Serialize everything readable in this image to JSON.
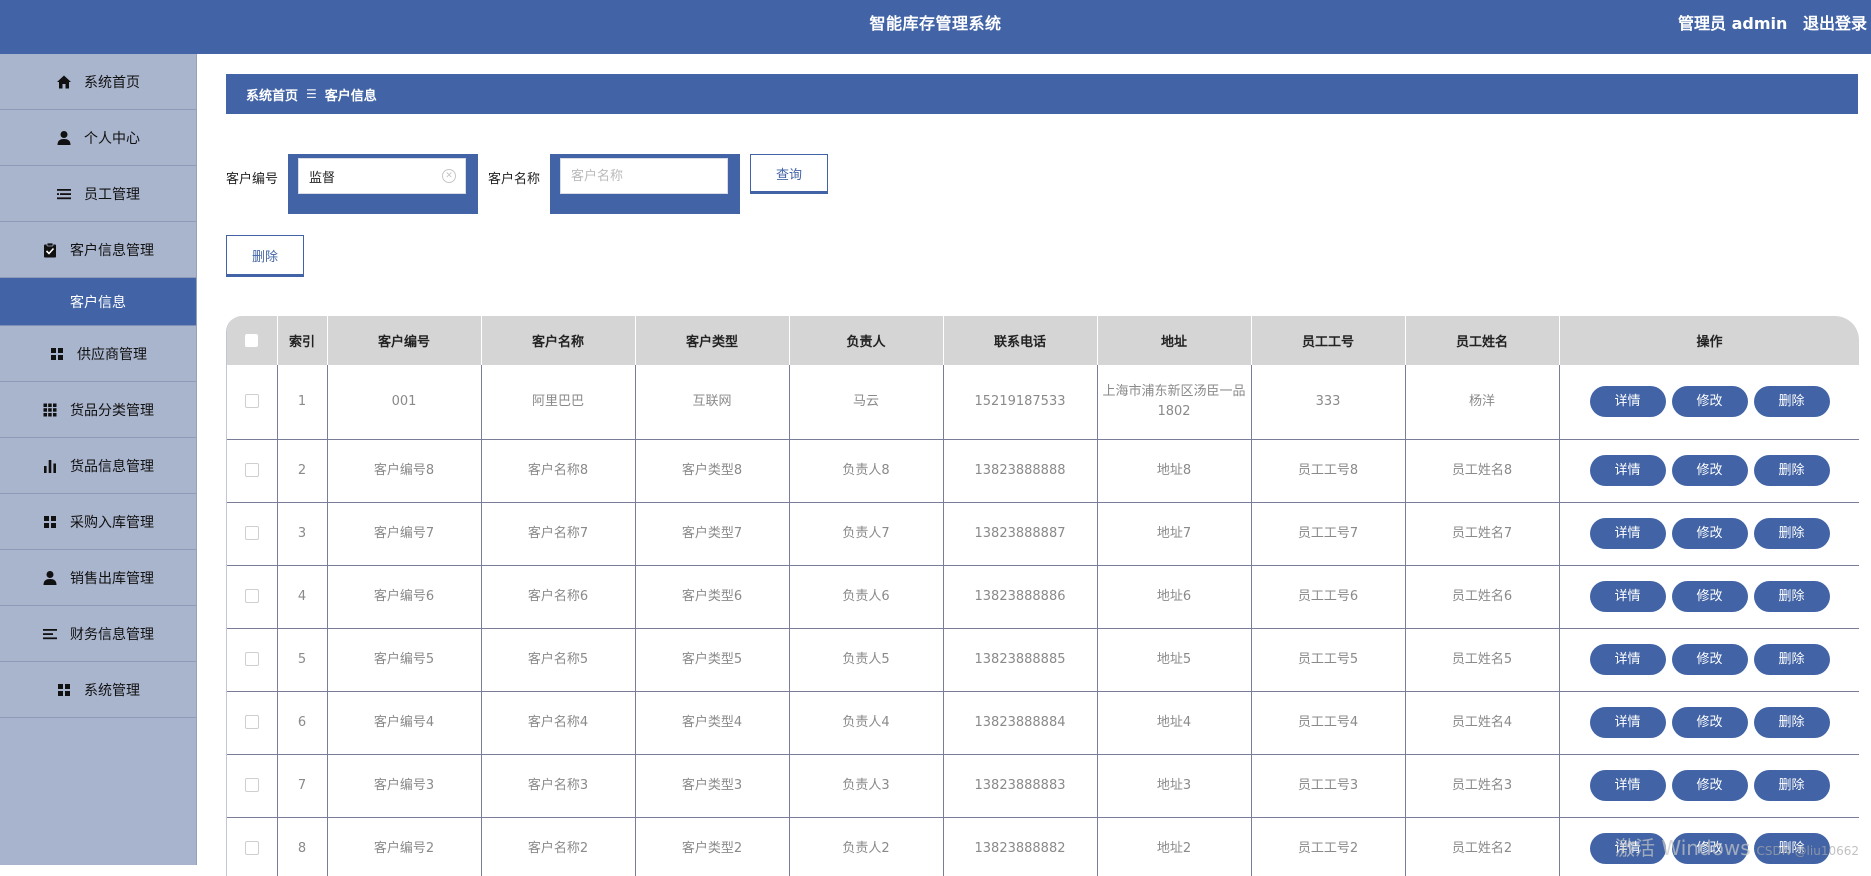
{
  "header": {
    "title": "智能库存管理系统",
    "user_label": "管理员 admin",
    "logout_label": "退出登录"
  },
  "sidebar": {
    "items": [
      {
        "label": "系统首页",
        "icon": "home-icon"
      },
      {
        "label": "个人中心",
        "icon": "user-icon"
      },
      {
        "label": "员工管理",
        "icon": "list-icon"
      },
      {
        "label": "客户信息管理",
        "icon": "clipboard-check-icon"
      },
      {
        "label": "客户信息",
        "icon": ""
      },
      {
        "label": "供应商管理",
        "icon": "grid-icon"
      },
      {
        "label": "货品分类管理",
        "icon": "apps-icon"
      },
      {
        "label": "货品信息管理",
        "icon": "bar-chart-icon"
      },
      {
        "label": "采购入库管理",
        "icon": "grid-icon"
      },
      {
        "label": "销售出库管理",
        "icon": "user-icon"
      },
      {
        "label": "财务信息管理",
        "icon": "list-icon"
      },
      {
        "label": "系统管理",
        "icon": "grid-icon"
      }
    ]
  },
  "breadcrumb": {
    "home": "系统首页",
    "separator": "☰",
    "current": "客户信息"
  },
  "search": {
    "field1_label": "客户编号",
    "field1_value": "监督",
    "field2_label": "客户名称",
    "field2_placeholder": "客户名称",
    "query_label": "查询"
  },
  "toolbar": {
    "delete_label": "删除"
  },
  "table": {
    "columns": [
      "索引",
      "客户编号",
      "客户名称",
      "客户类型",
      "负责人",
      "联系电话",
      "地址",
      "员工工号",
      "员工姓名",
      "操作"
    ],
    "rows": [
      {
        "index": "1",
        "code": "001",
        "name": "阿里巴巴",
        "type": "互联网",
        "owner": "马云",
        "phone": "15219187533",
        "address": "上海市浦东新区汤臣一品1802",
        "emp_no": "333",
        "emp_name": "杨洋"
      },
      {
        "index": "2",
        "code": "客户编号8",
        "name": "客户名称8",
        "type": "客户类型8",
        "owner": "负责人8",
        "phone": "13823888888",
        "address": "地址8",
        "emp_no": "员工工号8",
        "emp_name": "员工姓名8"
      },
      {
        "index": "3",
        "code": "客户编号7",
        "name": "客户名称7",
        "type": "客户类型7",
        "owner": "负责人7",
        "phone": "13823888887",
        "address": "地址7",
        "emp_no": "员工工号7",
        "emp_name": "员工姓名7"
      },
      {
        "index": "4",
        "code": "客户编号6",
        "name": "客户名称6",
        "type": "客户类型6",
        "owner": "负责人6",
        "phone": "13823888886",
        "address": "地址6",
        "emp_no": "员工工号6",
        "emp_name": "员工姓名6"
      },
      {
        "index": "5",
        "code": "客户编号5",
        "name": "客户名称5",
        "type": "客户类型5",
        "owner": "负责人5",
        "phone": "13823888885",
        "address": "地址5",
        "emp_no": "员工工号5",
        "emp_name": "员工姓名5"
      },
      {
        "index": "6",
        "code": "客户编号4",
        "name": "客户名称4",
        "type": "客户类型4",
        "owner": "负责人4",
        "phone": "13823888884",
        "address": "地址4",
        "emp_no": "员工工号4",
        "emp_name": "员工姓名4"
      },
      {
        "index": "7",
        "code": "客户编号3",
        "name": "客户名称3",
        "type": "客户类型3",
        "owner": "负责人3",
        "phone": "13823888883",
        "address": "地址3",
        "emp_no": "员工工号3",
        "emp_name": "员工姓名3"
      },
      {
        "index": "8",
        "code": "客户编号2",
        "name": "客户名称2",
        "type": "客户类型2",
        "owner": "负责人2",
        "phone": "13823888882",
        "address": "地址2",
        "emp_no": "员工工号2",
        "emp_name": "员工姓名2"
      }
    ],
    "actions": {
      "detail": "详情",
      "edit": "修改",
      "delete": "删除"
    }
  },
  "watermark": {
    "activate": "激活 Windows",
    "csdn": "CSDN @liu10662"
  },
  "colors": {
    "primary": "#4264a6",
    "sidebar_bg": "#a9b4cd",
    "header_row_bg": "#d5d5d5"
  }
}
